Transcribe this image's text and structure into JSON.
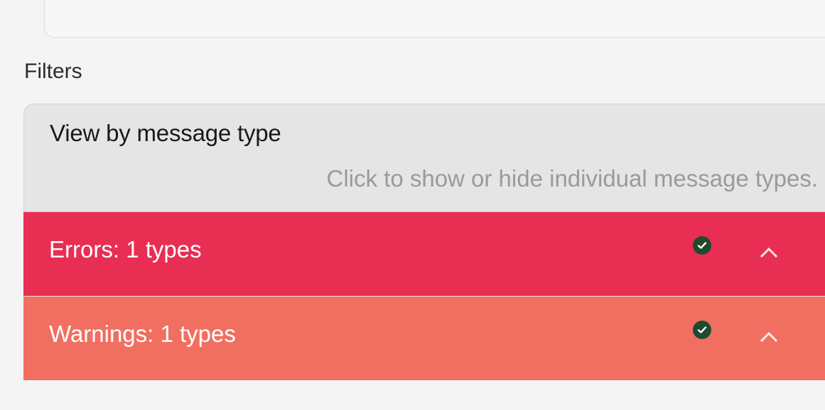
{
  "filters": {
    "heading": "Filters"
  },
  "panel": {
    "title": "View by message type",
    "description": "Click to show or hide individual message types."
  },
  "rows": [
    {
      "label": "Errors: 1 types",
      "checked": true,
      "expanded": true,
      "color": "#e92e53",
      "icons": [
        "check-icon",
        "chevron-up-icon"
      ]
    },
    {
      "label": "Warnings: 1 types",
      "checked": true,
      "expanded": true,
      "color": "#f16f61",
      "icons": [
        "check-icon",
        "chevron-up-icon"
      ]
    }
  ],
  "colors": {
    "background": "#f4f4f4",
    "panel_header": "#e5e5e5",
    "description_text": "#9a9a9a",
    "check_badge": "#1e4a2e",
    "link": "#2a5db0"
  }
}
